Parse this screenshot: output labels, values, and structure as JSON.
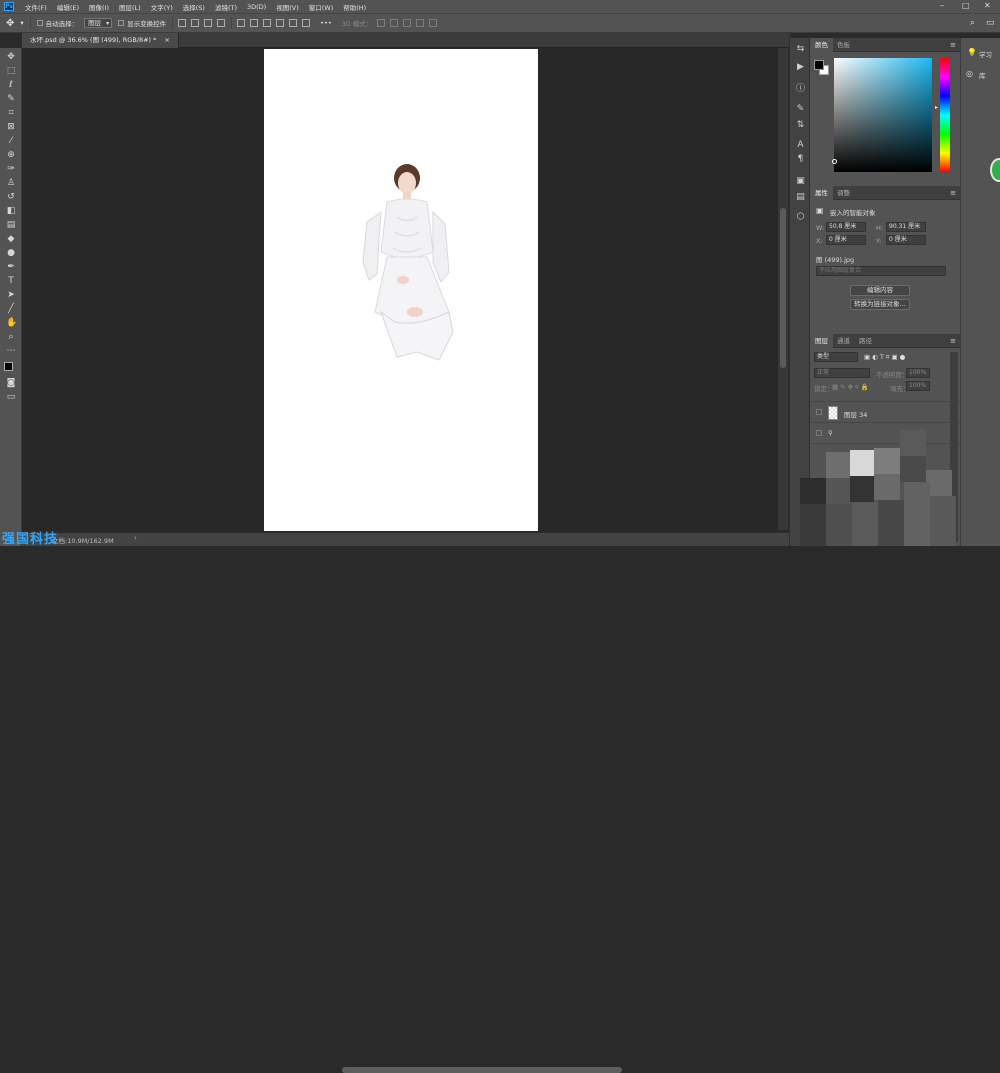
{
  "app": {
    "logo": "Ps"
  },
  "menu": [
    "文件(F)",
    "编辑(E)",
    "图像(I)",
    "图层(L)",
    "文字(Y)",
    "选择(S)",
    "滤镜(T)",
    "3D(D)",
    "视图(V)",
    "窗口(W)",
    "帮助(H)"
  ],
  "window_controls": {
    "minimize": "–",
    "maximize": "□",
    "close": "✕"
  },
  "options_bar": {
    "auto_select_label": "自动选择：",
    "auto_select_value": "图层",
    "show_transform_label": "显示变换控件",
    "more": "•••",
    "mode_3d": "3D 模式："
  },
  "document_tab": {
    "title": "水坏.psd @ 36.6% (图 (499), RGB/8#) *",
    "close": "×"
  },
  "status": {
    "text": "文档:10.9M/162.9M"
  },
  "watermark": {
    "text": "强国科技"
  },
  "color_panel": {
    "tabs": [
      "颜色",
      "色板"
    ],
    "foreground": "#000000",
    "background": "#ffffff",
    "hue_color": "#19b8f0"
  },
  "properties_panel": {
    "tabs": [
      "属性",
      "调整"
    ],
    "type_label": "嵌入的智能对象",
    "w_label": "W:",
    "w_value": "50.8 厘米",
    "h_label": "H:",
    "h_value": "90.31 厘米",
    "x_label": "X:",
    "x_value": "0 厘米",
    "y_label": "Y:",
    "y_value": "0 厘米",
    "filename": "图 (499).jpg",
    "comp_placeholder": "不应用图层复合",
    "edit_button": "编辑内容",
    "convert_button": "转换为链接对象..."
  },
  "layers_panel": {
    "tabs": [
      "图层",
      "通道",
      "路径"
    ],
    "filter_value": "类型",
    "blend_mode": "正常",
    "opacity_label": "不透明度：",
    "opacity_value": "100%",
    "lock_label": "锁定：",
    "fill_label": "填充：",
    "fill_value": "100%",
    "layers": [
      {
        "name": "图层 34"
      }
    ]
  },
  "right_panel": {
    "learn_label": "学习",
    "library_label": "库"
  },
  "accent_color": "#31a8ff",
  "brand_badge_color": "#2fb24a"
}
